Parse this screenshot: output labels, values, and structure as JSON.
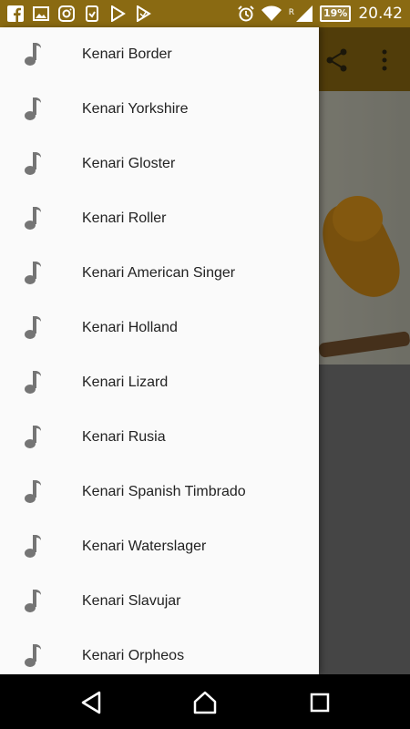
{
  "status_bar": {
    "battery": "19%",
    "time": "20.42",
    "roaming_indicator": "R",
    "icons": [
      "facebook-icon",
      "image-icon",
      "instagram-icon",
      "download-icon",
      "play-store-icon",
      "play-store-icon",
      "alarm-icon",
      "wifi-icon",
      "signal-icon",
      "battery-icon"
    ]
  },
  "toolbar": {
    "icons": [
      "share-icon",
      "more-vert-icon"
    ],
    "color": "#7d5e10"
  },
  "drawer": {
    "items": [
      {
        "label": "Kenari Border",
        "icon": "music-note-icon"
      },
      {
        "label": "Kenari Yorkshire",
        "icon": "music-note-icon"
      },
      {
        "label": "Kenari Gloster",
        "icon": "music-note-icon"
      },
      {
        "label": "Kenari Roller",
        "icon": "music-note-icon"
      },
      {
        "label": "Kenari American Singer",
        "icon": "music-note-icon"
      },
      {
        "label": "Kenari Holland",
        "icon": "music-note-icon"
      },
      {
        "label": "Kenari Lizard",
        "icon": "music-note-icon"
      },
      {
        "label": "Kenari Rusia",
        "icon": "music-note-icon"
      },
      {
        "label": "Kenari Spanish Timbrado",
        "icon": "music-note-icon"
      },
      {
        "label": "Kenari Waterslager",
        "icon": "music-note-icon"
      },
      {
        "label": "Kenari Slavujar",
        "icon": "music-note-icon"
      },
      {
        "label": "Kenari Orpheos",
        "icon": "music-note-icon"
      }
    ]
  },
  "nav_bar": {
    "icons": [
      "back-icon",
      "home-icon",
      "recents-icon"
    ]
  },
  "colors": {
    "status_bar": "#8a6a12",
    "drawer_bg": "#fafafa",
    "icon_gray": "#757575"
  }
}
